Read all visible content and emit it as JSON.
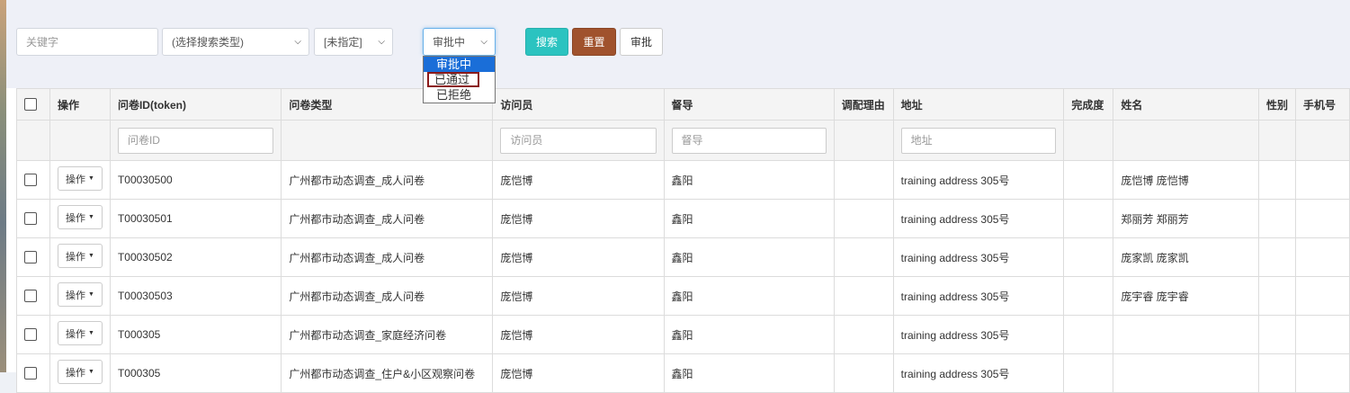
{
  "toolbar": {
    "keyword_placeholder": "关键字",
    "search_type": "(选择搜索类型)",
    "unspecified": "[未指定]",
    "status_current": "审批中",
    "search_label": "搜索",
    "reset_label": "重置",
    "approve_label": "审批"
  },
  "status_dropdown": {
    "options": [
      "审批中",
      "已通过",
      "已拒绝"
    ],
    "selected": "审批中",
    "hovered": "已通过"
  },
  "table": {
    "headers": {
      "operation": "操作",
      "token": "问卷ID(token)",
      "type": "问卷类型",
      "interviewer": "访问员",
      "supervisor": "督导",
      "reason": "调配理由",
      "address": "地址",
      "completion": "完成度",
      "name": "姓名",
      "gender": "性别",
      "phone": "手机号"
    },
    "filters": {
      "token_placeholder": "问卷ID",
      "interviewer_placeholder": "访问员",
      "supervisor_placeholder": "督导",
      "address_placeholder": "地址"
    },
    "op_button_label": "操作",
    "rows": [
      {
        "token": "T00030500",
        "type": "广州都市动态调查_成人问卷",
        "interviewer": "庞恺博",
        "supervisor": "鑫阳",
        "address": "training address 305号",
        "name": "庞恺博 庞恺博"
      },
      {
        "token": "T00030501",
        "type": "广州都市动态调查_成人问卷",
        "interviewer": "庞恺博",
        "supervisor": "鑫阳",
        "address": "training address 305号",
        "name": "郑丽芳 郑丽芳"
      },
      {
        "token": "T00030502",
        "type": "广州都市动态调查_成人问卷",
        "interviewer": "庞恺博",
        "supervisor": "鑫阳",
        "address": "training address 305号",
        "name": "庞家凯 庞家凯"
      },
      {
        "token": "T00030503",
        "type": "广州都市动态调查_成人问卷",
        "interviewer": "庞恺博",
        "supervisor": "鑫阳",
        "address": "training address 305号",
        "name": "庞宇睿 庞宇睿"
      },
      {
        "token": "T000305",
        "type": "广州都市动态调查_家庭经济问卷",
        "interviewer": "庞恺博",
        "supervisor": "鑫阳",
        "address": "training address 305号",
        "name": ""
      },
      {
        "token": "T000305",
        "type": "广州都市动态调查_住户&小区观察问卷",
        "interviewer": "庞恺博",
        "supervisor": "鑫阳",
        "address": "training address 305号",
        "name": ""
      }
    ]
  }
}
